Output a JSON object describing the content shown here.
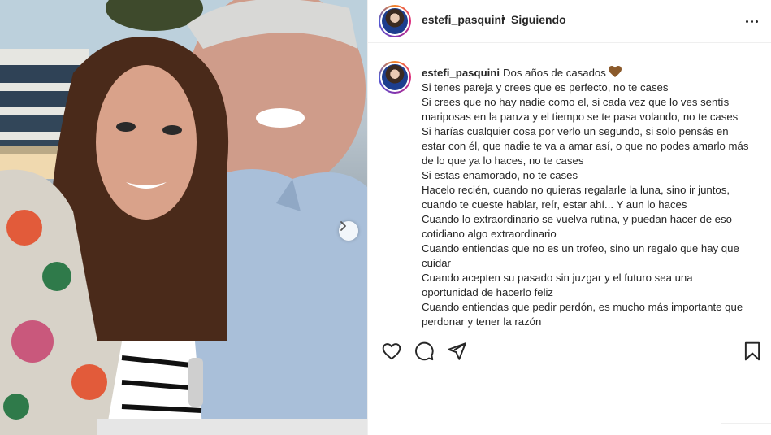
{
  "header": {
    "username": "estefi_pasquini",
    "separator": "•",
    "follow_status": "Siguiendo"
  },
  "caption": {
    "username": "estefi_pasquini",
    "lines": [
      "Dos años de casados",
      "Si tenes pareja y crees que es perfecto, no te cases",
      "Si crees que no hay nadie como el, si cada vez que lo ves sentís",
      "mariposas en la panza y el tiempo se te pasa volando, no te cases",
      "Si harías cualquier cosa por verlo un segundo, si solo pensás en",
      "estar con él, que nadie te va a amar así, o que no podes amarlo más",
      "de lo que ya lo haces, no te cases",
      "Si estas enamorado, no te cases",
      "Hacelo recién, cuando no quieras regalarle la luna, sino ir juntos,",
      "cuando te cueste hablar, reír, estar ahí... Y aun lo haces",
      "Cuando lo extraordinario se vuelva rutina, y puedan hacer de eso",
      "cotidiano algo extraordinario",
      "Cuando entiendas que no es un trofeo, sino un regalo que hay que",
      "cuidar",
      "Cuando acepten su pasado sin juzgar y el futuro sea una",
      "oportunidad de hacerlo feliz",
      "Cuando entiendas que pedir perdón, es mucho más importante que",
      "perdonar y tener la razón"
    ],
    "emoji": "brown-heart"
  },
  "icons": {
    "like": "heart-outline-icon",
    "comment": "comment-bubble-icon",
    "share": "paper-plane-icon",
    "save": "bookmark-icon",
    "more": "ellipsis-icon",
    "carousel": "chevron-right-icon"
  },
  "colors": {
    "text": "#262626",
    "border": "#efefef",
    "heart_emoji": "#8b5a2b"
  }
}
